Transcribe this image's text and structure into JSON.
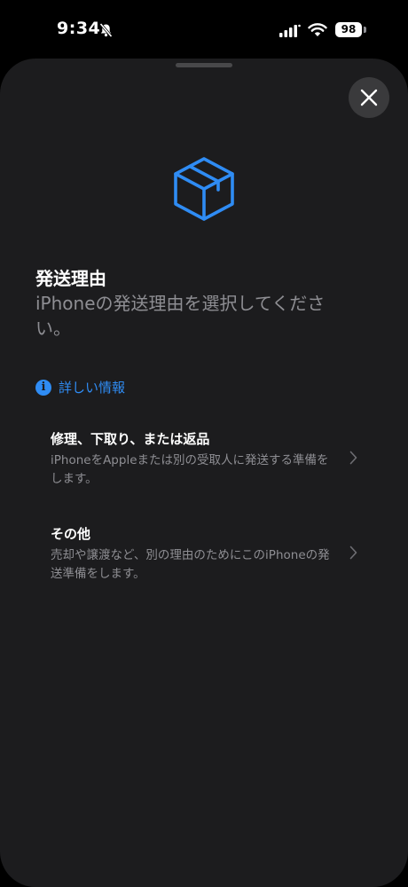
{
  "status_bar": {
    "time": "9:34",
    "battery": "98",
    "icons": [
      "bell-slash-icon",
      "signal-icon",
      "wifi-icon",
      "battery-icon"
    ]
  },
  "sheet": {
    "close_icon": "close-icon",
    "header_icon": "shipping-box-icon",
    "accent_color": "#2f8cf4",
    "title": "発送理由",
    "subtitle": "iPhoneの発送理由を選択してください。",
    "info_link": {
      "icon": "info-icon",
      "label": "詳しい情報"
    },
    "options": [
      {
        "title": "修理、下取り、または返品",
        "description": "iPhoneをAppleまたは別の受取人に発送する準備をします。"
      },
      {
        "title": "その他",
        "description": "売却や譲渡など、別の理由のためにこのiPhoneの発送準備をします。"
      }
    ]
  }
}
